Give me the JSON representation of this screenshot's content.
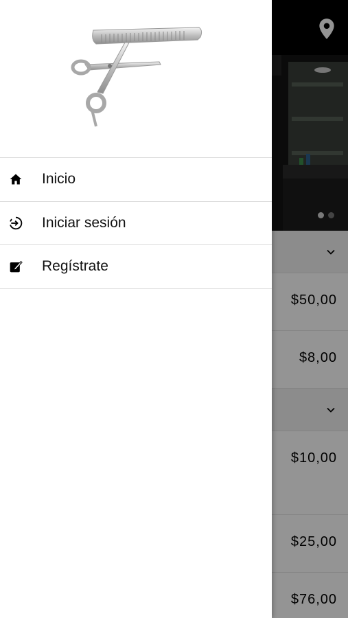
{
  "drawer": {
    "menu": [
      {
        "label": "Inicio",
        "icon": "home-icon"
      },
      {
        "label": "Iniciar sesión",
        "icon": "login-icon"
      },
      {
        "label": "Regístrate",
        "icon": "register-icon"
      }
    ]
  },
  "background": {
    "icon": "location-pin-icon",
    "prices": [
      "$50,00",
      "$8,00",
      "$10,00",
      "$25,00",
      "$76,00"
    ]
  },
  "colors": {
    "topbar": "#000000",
    "scrim": "#000000",
    "drawer": "#ffffff"
  }
}
